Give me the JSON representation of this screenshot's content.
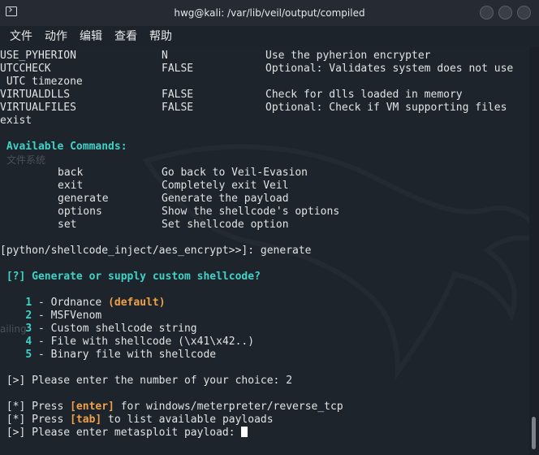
{
  "window": {
    "title": "hwg@kali: /var/lib/veil/output/compiled"
  },
  "menu": [
    "文件",
    "动作",
    "编辑",
    "查看",
    "帮助"
  ],
  "options": [
    {
      "name": "USE_PYHERION",
      "value": "N",
      "desc": "Use the pyherion encrypter"
    },
    {
      "name": "UTCCHECK",
      "value": "FALSE",
      "desc": "Optional: Validates system does not use",
      "wrap": " UTC timezone"
    },
    {
      "name": "VIRTUALDLLS",
      "value": "FALSE",
      "desc": "Check for dlls loaded in memory"
    },
    {
      "name": "VIRTUALFILES",
      "value": "FALSE",
      "desc": "Optional: Check if VM supporting files",
      "wrap": "exist"
    }
  ],
  "commands_header": " Available Commands:",
  "commands": [
    {
      "cmd": "back",
      "desc": "Go back to Veil-Evasion"
    },
    {
      "cmd": "exit",
      "desc": "Completely exit Veil"
    },
    {
      "cmd": "generate",
      "desc": "Generate the payload"
    },
    {
      "cmd": "options",
      "desc": "Show the shellcode's options"
    },
    {
      "cmd": "set",
      "desc": "Set shellcode option"
    }
  ],
  "prompt_line": "[python/shellcode_inject/aes_encrypt>>]: generate",
  "question": " [?] Generate or supply custom shellcode?",
  "choices": [
    {
      "num": "1",
      "label": "Ordnance ",
      "extra": "(default)"
    },
    {
      "num": "2",
      "label": "MSFVenom",
      "extra": ""
    },
    {
      "num": "3",
      "label": "Custom shellcode string",
      "extra": ""
    },
    {
      "num": "4",
      "label": "File with shellcode (\\x41\\x42..)",
      "extra": ""
    },
    {
      "num": "5",
      "label": "Binary file with shellcode",
      "extra": ""
    }
  ],
  "choice_prompt": " [>] Please enter the number of your choice: 2",
  "enter_line": {
    "pre": " [*] Press ",
    "key": "[enter]",
    "post": " for windows/meterpreter/reverse_tcp"
  },
  "tab_line": {
    "pre": " [*] Press ",
    "key": "[tab]",
    "post": " to list available payloads"
  },
  "payload_prompt": " [>] Please enter metasploit payload: ",
  "colors": {
    "accent_cyan": "#3fd2c7",
    "accent_orange": "#f0a146",
    "background": "#1e242c"
  },
  "desktop_ghost": [
    "文件系统",
    "ailing"
  ]
}
